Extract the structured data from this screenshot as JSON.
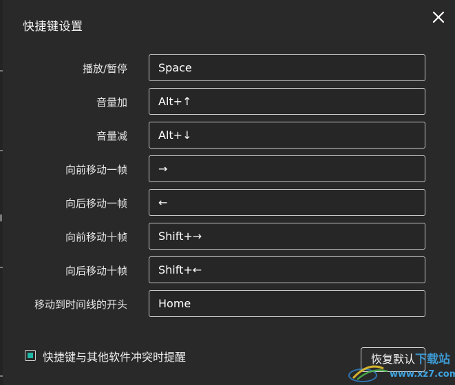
{
  "dialog": {
    "title": "快捷键设置",
    "close_icon": "close-icon"
  },
  "shortcuts": [
    {
      "label": "播放/暂停",
      "key": "Space"
    },
    {
      "label": "音量加",
      "key": "Alt+↑"
    },
    {
      "label": "音量减",
      "key": "Alt+↓"
    },
    {
      "label": "向前移动一帧",
      "key": "→"
    },
    {
      "label": "向后移动一帧",
      "key": "←"
    },
    {
      "label": "向前移动十帧",
      "key": "Shift+→"
    },
    {
      "label": "向后移动十帧",
      "key": "Shift+←"
    },
    {
      "label": "移动到时间线的开头",
      "key": "Home"
    }
  ],
  "footer": {
    "conflict_reminder_label": "快捷键与其他软件冲突时提醒",
    "conflict_reminder_checked": true,
    "reset_label": "恢复默认"
  },
  "watermark": {
    "text": "www.xz7.com",
    "brand_text": "下载站"
  },
  "colors": {
    "background": "#292929",
    "accent": "#1fb7a6",
    "field_border": "#c9c9c9"
  }
}
